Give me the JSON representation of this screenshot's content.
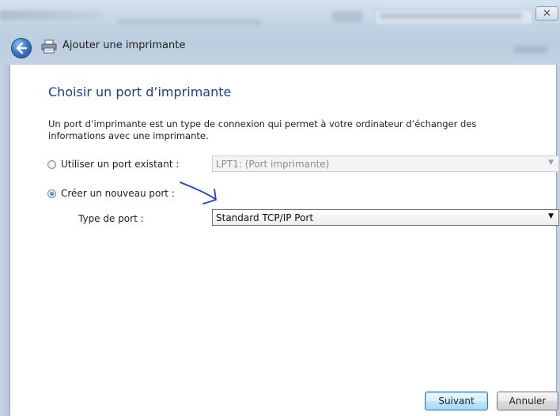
{
  "window": {
    "title": "Ajouter une imprimante",
    "close_symbol": "✕"
  },
  "page": {
    "heading": "Choisir un port d’imprimante",
    "description": "Un port d’imprimante est un type de connexion qui permet à votre ordinateur d’échanger des informations avec une imprimante."
  },
  "options": {
    "existing": {
      "label": "Utiliser un port existant :",
      "selected": false,
      "value": "LPT1: (Port imprimante)"
    },
    "new": {
      "label": "Créer un nouveau port :",
      "selected": true,
      "port_type_label": "Type de port :",
      "port_type_value": "Standard TCP/IP Port"
    }
  },
  "buttons": {
    "next": "Suivant",
    "cancel": "Annuler"
  },
  "icons": {
    "back": "back-arrow-icon",
    "printer": "printer-icon",
    "dropdown": "chevron-down-icon"
  },
  "colors": {
    "heading": "#1a3f8f",
    "annotation": "#1f3fe0"
  }
}
